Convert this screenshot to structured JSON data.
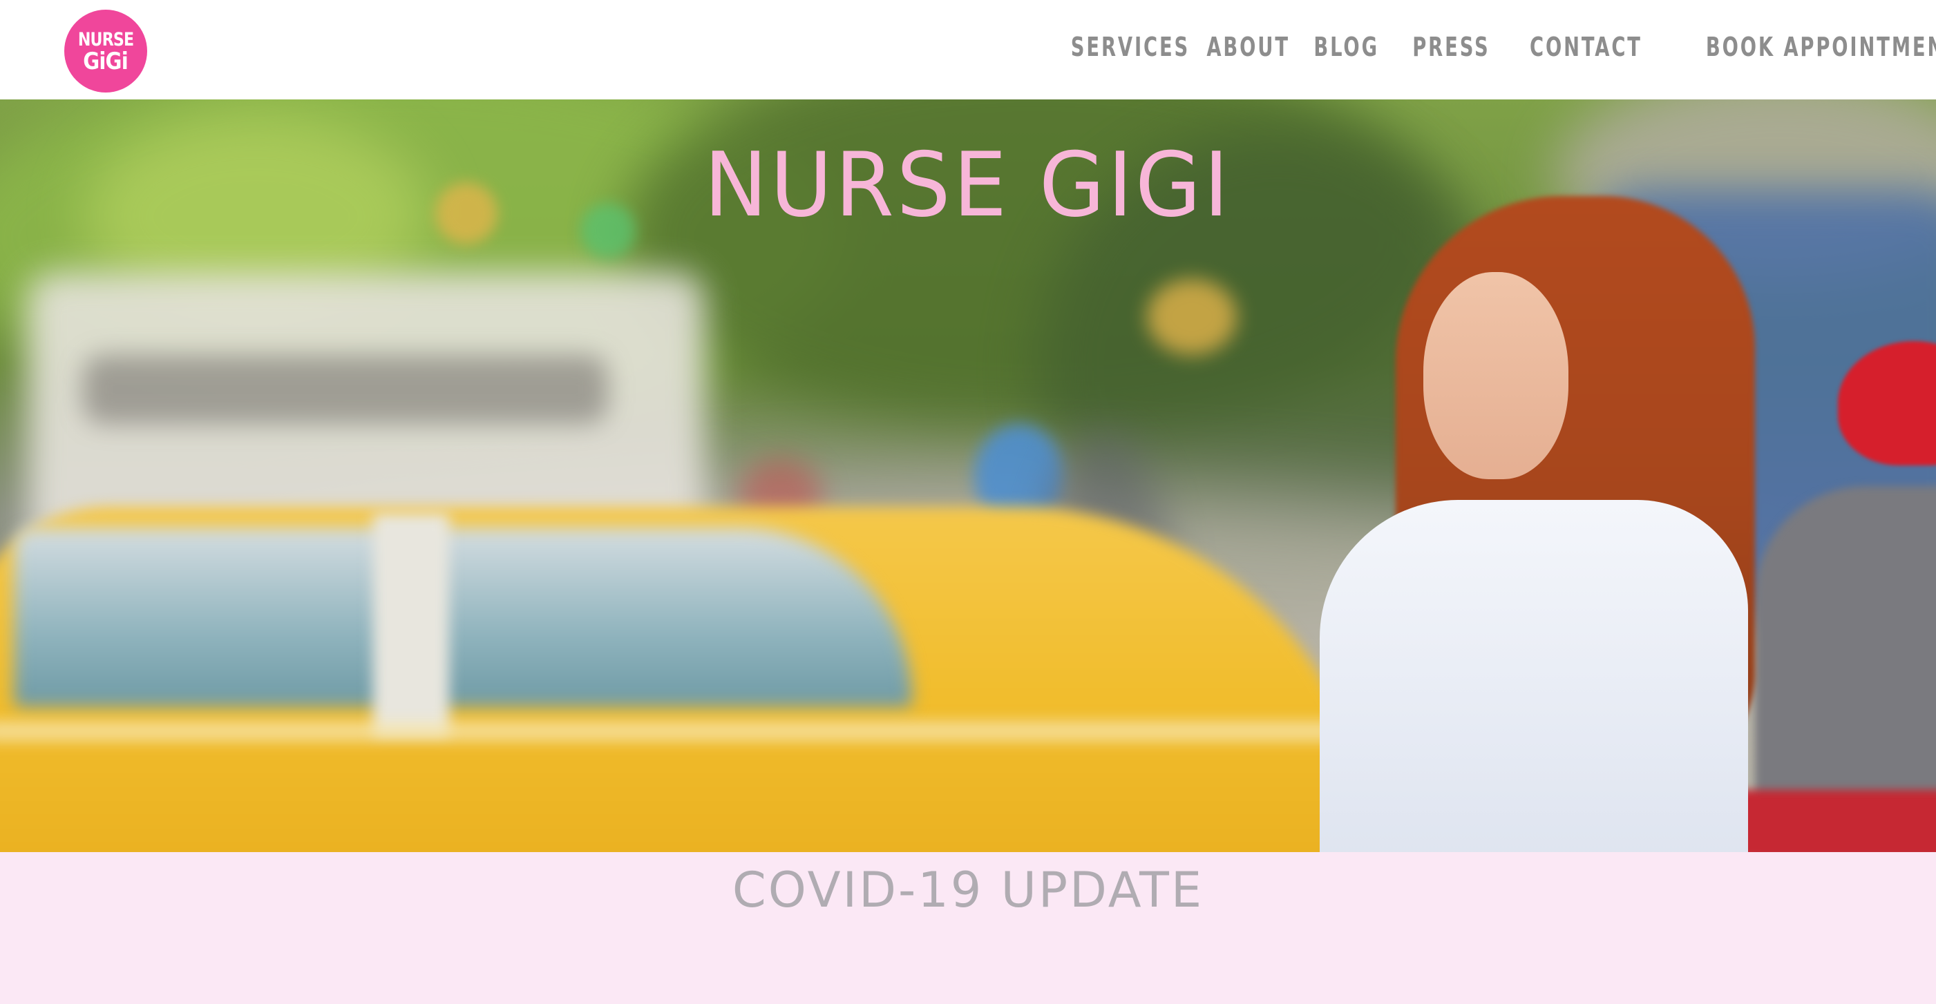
{
  "header": {
    "logo": {
      "line1": "NURSE",
      "line2": "GiGi"
    },
    "nav": [
      {
        "label": "SERVICES"
      },
      {
        "label": "ABOUT"
      },
      {
        "label": "BLOG"
      },
      {
        "label": "PRESS"
      },
      {
        "label": "CONTACT"
      },
      {
        "label": "BOOK APPOINTMENT"
      }
    ]
  },
  "hero": {
    "title": "NURSE GIGI",
    "image": "nurse-on-street-photo"
  },
  "covid": {
    "title": "COVID-19 UPDATE"
  },
  "colors": {
    "brand_pink": "#f0469b",
    "hero_title": "#f7b6d8",
    "nav_text": "#8d8d8d",
    "covid_band": "#fbe8f5",
    "covid_text": "#b0acb2"
  }
}
